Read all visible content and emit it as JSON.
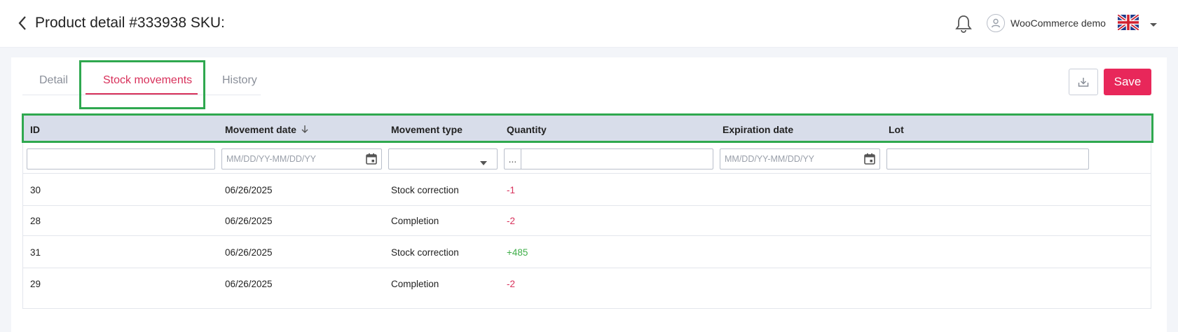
{
  "header": {
    "title": "Product detail #333938 SKU:",
    "user_name": "WooCommerce demo",
    "language_flag": "uk-flag-icon"
  },
  "tabs": [
    {
      "label": "Detail",
      "active": false
    },
    {
      "label": "Stock movements",
      "active": true
    },
    {
      "label": "History",
      "active": false
    }
  ],
  "actions": {
    "export_icon": "download-icon",
    "save_label": "Save"
  },
  "table": {
    "columns": [
      "ID",
      "Movement date",
      "Movement type",
      "Quantity",
      "Expiration date",
      "Lot"
    ],
    "sort": {
      "column": "Movement date",
      "direction": "desc"
    },
    "filters": {
      "id": "",
      "movement_date_placeholder": "MM/DD/YY-MM/DD/YY",
      "movement_type": "",
      "quantity_prefix": "...",
      "quantity": "",
      "expiration_date_placeholder": "MM/DD/YY-MM/DD/YY",
      "lot": ""
    },
    "rows": [
      {
        "id": "30",
        "date": "06/26/2025",
        "type": "Stock correction",
        "quantity": "-1",
        "expiration": "",
        "lot": ""
      },
      {
        "id": "28",
        "date": "06/26/2025",
        "type": "Completion",
        "quantity": "-2",
        "expiration": "",
        "lot": ""
      },
      {
        "id": "31",
        "date": "06/26/2025",
        "type": "Stock correction",
        "quantity": "+485",
        "expiration": "",
        "lot": ""
      },
      {
        "id": "29",
        "date": "06/26/2025",
        "type": "Completion",
        "quantity": "-2",
        "expiration": "",
        "lot": ""
      }
    ]
  },
  "colors": {
    "accent": "#e8275a",
    "highlight_box": "#2fa84f",
    "header_bg": "#d8ddea",
    "negative": "#d8315b",
    "positive": "#3fae49"
  }
}
